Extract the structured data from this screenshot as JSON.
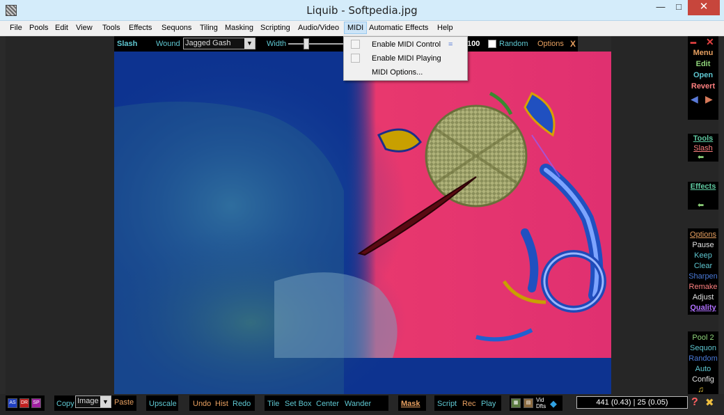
{
  "window": {
    "title": "Liquib - Softpedia.jpg",
    "min": "—",
    "max": "□",
    "close": "✕"
  },
  "menu": [
    "File",
    "Pools",
    "Edit",
    "View",
    "Tools",
    "Effects",
    "Sequons",
    "Tiling",
    "Masking",
    "Scripting",
    "Audio/Video",
    "MIDI",
    "Automatic Effects",
    "Help"
  ],
  "toolstrip": {
    "tool": "Slash",
    "wound_label": "Wound",
    "wound_value": "Jagged Gash",
    "width_label": "Width",
    "width_value": "100",
    "random_label": "Random",
    "options_label": "Options",
    "close_label": "X"
  },
  "midi_menu": {
    "items": [
      "Enable MIDI Control",
      "Enable MIDI Playing",
      "MIDI Options..."
    ],
    "equals": "="
  },
  "right_panel": {
    "menu": "Menu",
    "edit": "Edit",
    "open": "Open",
    "revert": "Revert",
    "tools": "Tools",
    "slash": "Slash",
    "effects": "Effects",
    "options": "Options",
    "pause": "Pause",
    "keep": "Keep",
    "clear": "Clear",
    "sharpen": "Sharpen",
    "remake": "Remake",
    "adjust": "Adjust",
    "quality": "Quality",
    "pool": "Pool 2",
    "sequon": "Sequon",
    "random": "Random",
    "auto": "Auto",
    "config": "Config",
    "help": "?"
  },
  "bottom_bar": {
    "icons": [
      "AS",
      "DR",
      "SP"
    ],
    "copy": "Copy",
    "copy_value": "Image",
    "paste": "Paste",
    "upscale": "Upscale",
    "undo": "Undo",
    "hist": "Hist",
    "redo": "Redo",
    "tile": "Tile",
    "setbox": "Set Box",
    "center": "Center",
    "wander": "Wander",
    "mask": "Mask",
    "script": "Script",
    "rec": "Rec",
    "play": "Play",
    "vid": "Vid",
    "dfts": "Dfts",
    "coords": "441 (0.43) | 25 (0.05)"
  },
  "colors": {
    "title_bg": "#d4ecfa",
    "close_bg": "#c7463c",
    "image_blue": "#0d3390",
    "image_pink": "#e8386e",
    "cyan_text": "#5fc8d2",
    "orange_text": "#e8a060",
    "green_text": "#8fd47a",
    "pink_text": "#ff8080",
    "purple_text": "#b070ff"
  }
}
